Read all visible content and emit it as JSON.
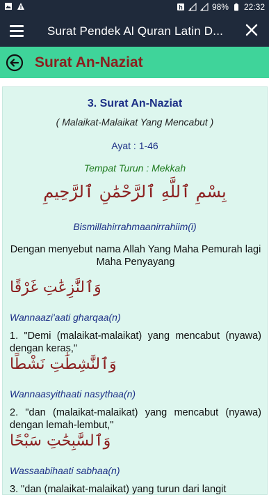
{
  "status_bar": {
    "battery": "98%",
    "time": "22:32"
  },
  "app_bar": {
    "title": "Surat Pendek Al Quran Latin D..."
  },
  "sub_header": {
    "title": "Surat An-Naziat"
  },
  "surah": {
    "title": "3. Surat An-Naziat",
    "meaning": "( Malaikat-Malaikat Yang Mencabut )",
    "ayat": "Ayat : 1-46",
    "tempat": "Tempat Turun : Mekkah",
    "basmala_arabic": "بِسْمِ ٱللَّهِ ٱلرَّحْمَٰنِ ٱلرَّحِيمِ",
    "basmala_latin": "Bismillahirrahmaanirrahiim(i)",
    "basmala_translation": "Dengan menyebut nama Allah Yang Maha Pemurah lagi Maha Penyayang"
  },
  "verses": [
    {
      "arabic": "وَٱلنَّٰزِعَٰتِ غَرْقًا",
      "latin": "Wannaazi'aati gharqaa(n)",
      "translation": "1. \"Demi (malaikat-malaikat) yang mencabut (nyawa) dengan keras,\""
    },
    {
      "arabic": "وَٱلنَّٰشِطَٰتِ نَشْطًا",
      "latin": "Wannaasyithaati nasythaa(n)",
      "translation": "2. \"dan (malaikat-malaikat) yang mencabut (nyawa) dengan lemah-lembut,\""
    },
    {
      "arabic": "وَٱلسَّٰبِحَٰتِ سَبْحًا",
      "latin": "Wassaabihaati sabhaa(n)",
      "translation": "3. \"dan (malaikat-malaikat) yang turun dari langit"
    }
  ]
}
